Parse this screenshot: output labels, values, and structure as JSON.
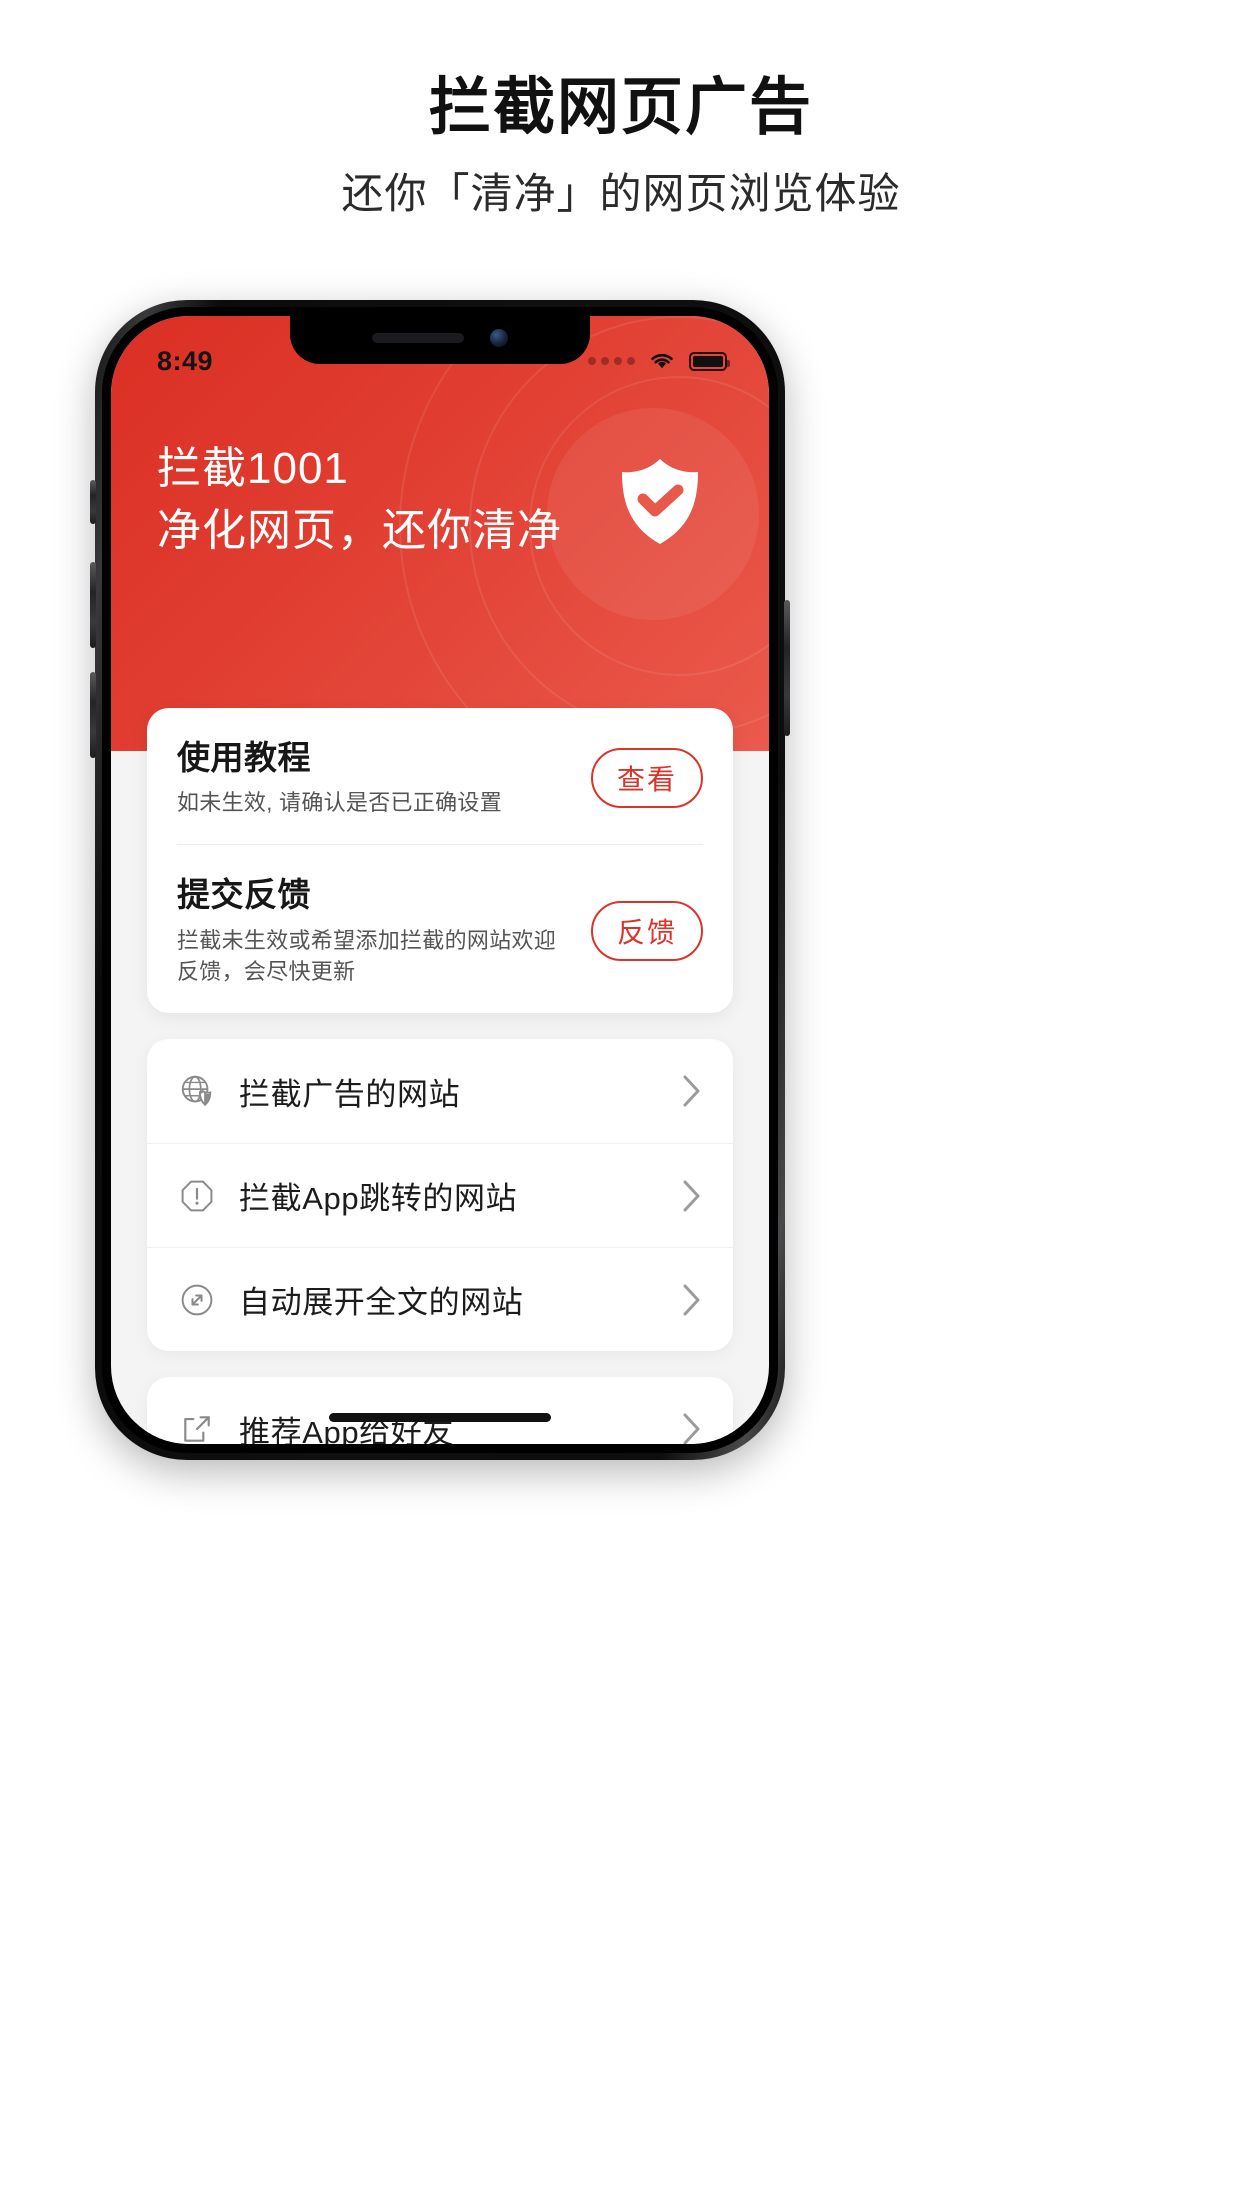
{
  "promo": {
    "title": "拦截网页广告",
    "subtitle": "还你「清净」的网页浏览体验"
  },
  "phone": {
    "statusbar": {
      "time": "8:49",
      "signal_icon": "signal-dots-icon",
      "wifi_icon": "wifi-icon",
      "battery_icon": "battery-full-icon"
    },
    "header": {
      "line1": "拦截1001",
      "line2": "净化网页，还你清净",
      "brand_icon": "shield-check-icon",
      "accent_color": "#db2f24",
      "accent_color_light": "#ea5a4c"
    },
    "card": {
      "rows": [
        {
          "title": "使用教程",
          "desc": "如未生效, 请确认是否已正确设置",
          "action": "查看",
          "action_color": "#d9342a"
        },
        {
          "title": "提交反馈",
          "desc": "拦截未生效或希望添加拦截的网站欢迎反馈，会尽快更新",
          "action": "反馈",
          "action_color": "#d9342a"
        }
      ]
    },
    "menu_group_1": [
      {
        "label": "拦截广告的网站",
        "icon": "globe-shield-icon",
        "chevron": "chevron-right-icon"
      },
      {
        "label": "拦截App跳转的网站",
        "icon": "octagon-exclamation-icon",
        "chevron": "chevron-right-icon"
      },
      {
        "label": "自动展开全文的网站",
        "icon": "expand-circle-icon",
        "chevron": "chevron-right-icon"
      }
    ],
    "menu_group_2": [
      {
        "label": "推荐App给好友",
        "icon": "share-external-icon",
        "chevron": "chevron-right-icon"
      }
    ]
  }
}
